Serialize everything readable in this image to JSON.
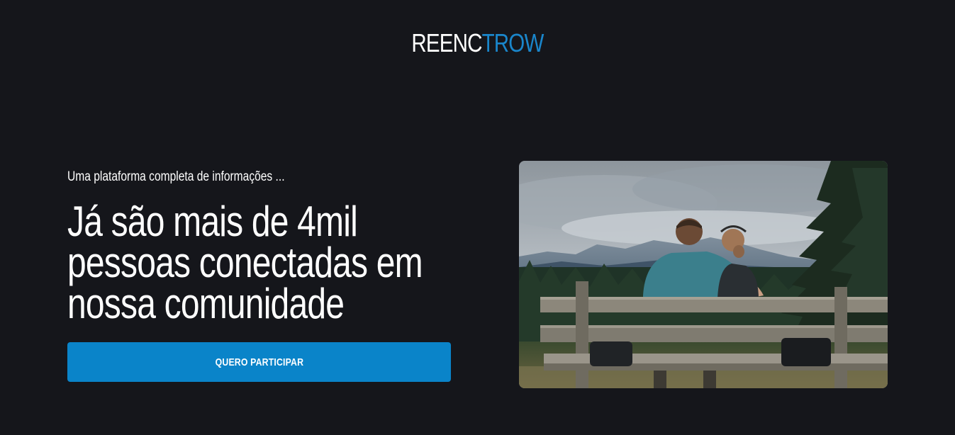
{
  "brand": {
    "part_a": "REENC",
    "part_b": "TROW",
    "accent_color": "#1a86cb"
  },
  "hero": {
    "kicker": "Uma plataforma completa de informações ...",
    "headline_line1": "Já são mais de 4mil",
    "headline_line2": "pessoas conectadas em",
    "headline_line3": "nossa comunidade",
    "cta_label": "QUERO PARTICIPAR"
  },
  "colors": {
    "background": "#15161b",
    "button": "#0a84c9"
  },
  "image": {
    "subject": "couple-on-bench-mountain-view"
  }
}
